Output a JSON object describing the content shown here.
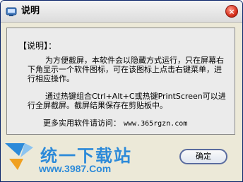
{
  "window": {
    "title": "说明"
  },
  "content": {
    "heading": "【说明】：",
    "paragraph1": "为方便截屏，本软件会以隐藏方式运行，只在屏幕右下角显示一个软件图标，可在该图标上点击右键菜单，进行相应操作。",
    "paragraph2": "通过热键组合Ctrl+Alt+C或热键PrintScreen可以进行全屏截屏。截屏结果保存在剪贴板中。",
    "more_label": "更多实用软件请访问：",
    "more_url": "www.365rgzn.com"
  },
  "watermark": {
    "name": "统一下载站",
    "url": "www.3987.Com"
  },
  "buttons": {
    "ok_label": "确定"
  },
  "icons": {
    "app": "app-icon",
    "close": "close-icon",
    "logo": "download-logo-icon"
  },
  "colors": {
    "window_bg": "#ece9d8",
    "close_red": "#d8321e",
    "watermark_blue": "#2c8ad9",
    "button_border": "#5a6c9f"
  }
}
